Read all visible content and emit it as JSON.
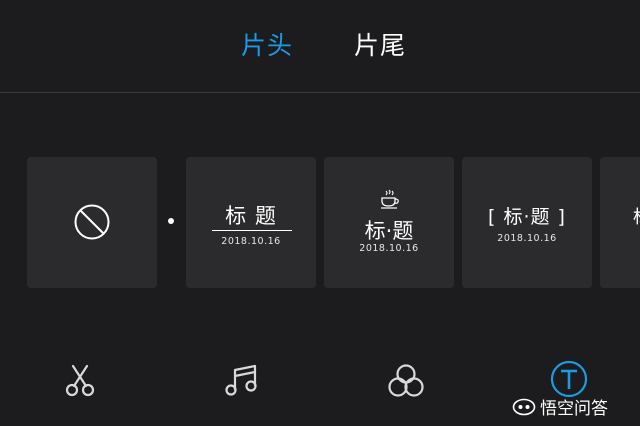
{
  "tabs": {
    "intro_label": "片头",
    "outro_label": "片尾"
  },
  "templates": [
    {
      "id": "none"
    },
    {
      "id": "style1",
      "title": "标 题",
      "date": "2018.10.16"
    },
    {
      "id": "style2",
      "title": "标·题",
      "date": "2018.10.16"
    },
    {
      "id": "style3",
      "title": "[ 标·题 ]",
      "date": "2018.10.16"
    },
    {
      "id": "style4",
      "title": "标"
    }
  ],
  "toolbar": {
    "icons": [
      "scissors-icon",
      "music-icon",
      "filter-icon",
      "text-icon"
    ]
  },
  "watermark": {
    "text": "悟空问答"
  },
  "colors": {
    "accent": "#1a9be8",
    "background": "#1c1c1e",
    "card": "#2b2b2d"
  }
}
